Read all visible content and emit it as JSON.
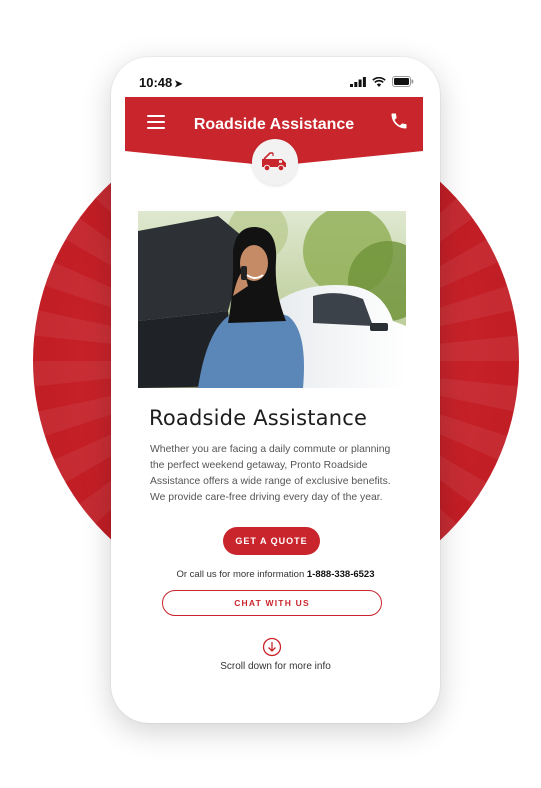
{
  "status_bar": {
    "time": "10:48",
    "location_arrow": "➤"
  },
  "header": {
    "title": "Roadside Assistance",
    "menu_icon": "hamburger-icon",
    "call_icon": "phone-icon",
    "badge_icon": "tow-truck-icon"
  },
  "main": {
    "heading": "Roadside Assistance",
    "description": "Whether you are facing a daily commute or planning the perfect weekend getaway, Pronto Roadside Assistance offers a wide range of exclusive benefits. We provide care-free driving every day of the year.",
    "quote_button": "GET A QUOTE",
    "call_text": "Or call us for more information",
    "phone_number": "1-888-338-6523",
    "chat_button": "CHAT WITH US",
    "scroll_text": "Scroll down for more info"
  },
  "colors": {
    "brand_red": "#c9252c",
    "background_circle": "#c51f27"
  }
}
